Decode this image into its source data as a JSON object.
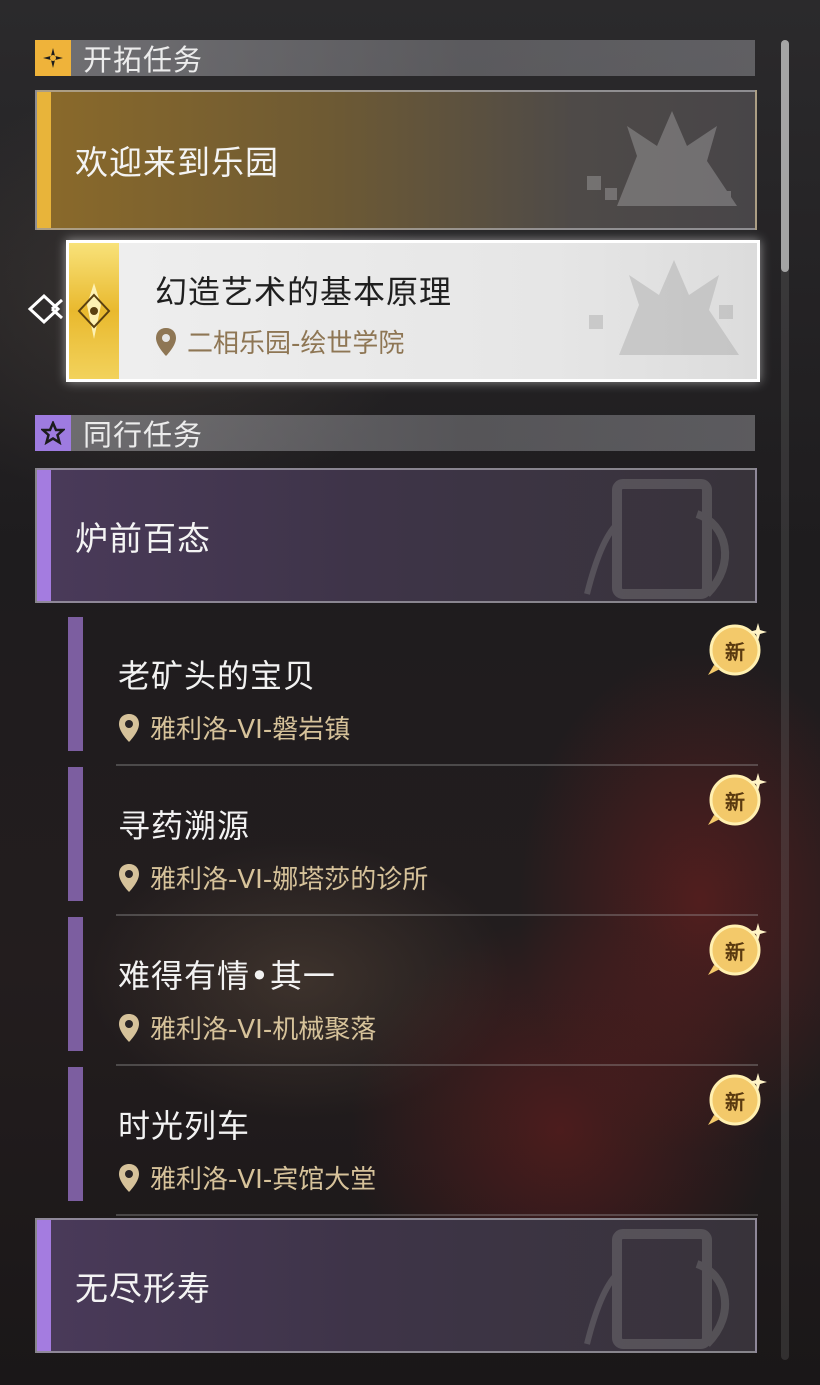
{
  "sections": {
    "trailblaze": {
      "title": "开拓任务",
      "icon": "trailblaze-icon",
      "chapter": {
        "title": "欢迎来到乐园",
        "accent": "#e8b43a"
      },
      "selected_quest": {
        "title": "幻造艺术的基本原理",
        "location": "二相乐园-绘世学院"
      }
    },
    "companion": {
      "title": "同行任务",
      "icon": "star-icon",
      "chapter": {
        "title": "炉前百态",
        "accent": "#a47ce0"
      },
      "quests": [
        {
          "title": "老矿头的宝贝",
          "location": "雅利洛-VI-磐岩镇",
          "badge": "新"
        },
        {
          "title": "寻药溯源",
          "location": "雅利洛-VI-娜塔莎的诊所",
          "badge": "新"
        },
        {
          "title": "难得有情•其一",
          "location": "雅利洛-VI-机械聚落",
          "badge": "新"
        },
        {
          "title": "时光列车",
          "location": "雅利洛-VI-宾馆大堂",
          "badge": "新"
        }
      ],
      "next_chapter": {
        "title": "无尽形寿",
        "accent": "#a47ce0"
      }
    }
  },
  "colors": {
    "gold": "#e8b43a",
    "purple": "#7c5ea0",
    "location_text": "#d6c29a"
  }
}
